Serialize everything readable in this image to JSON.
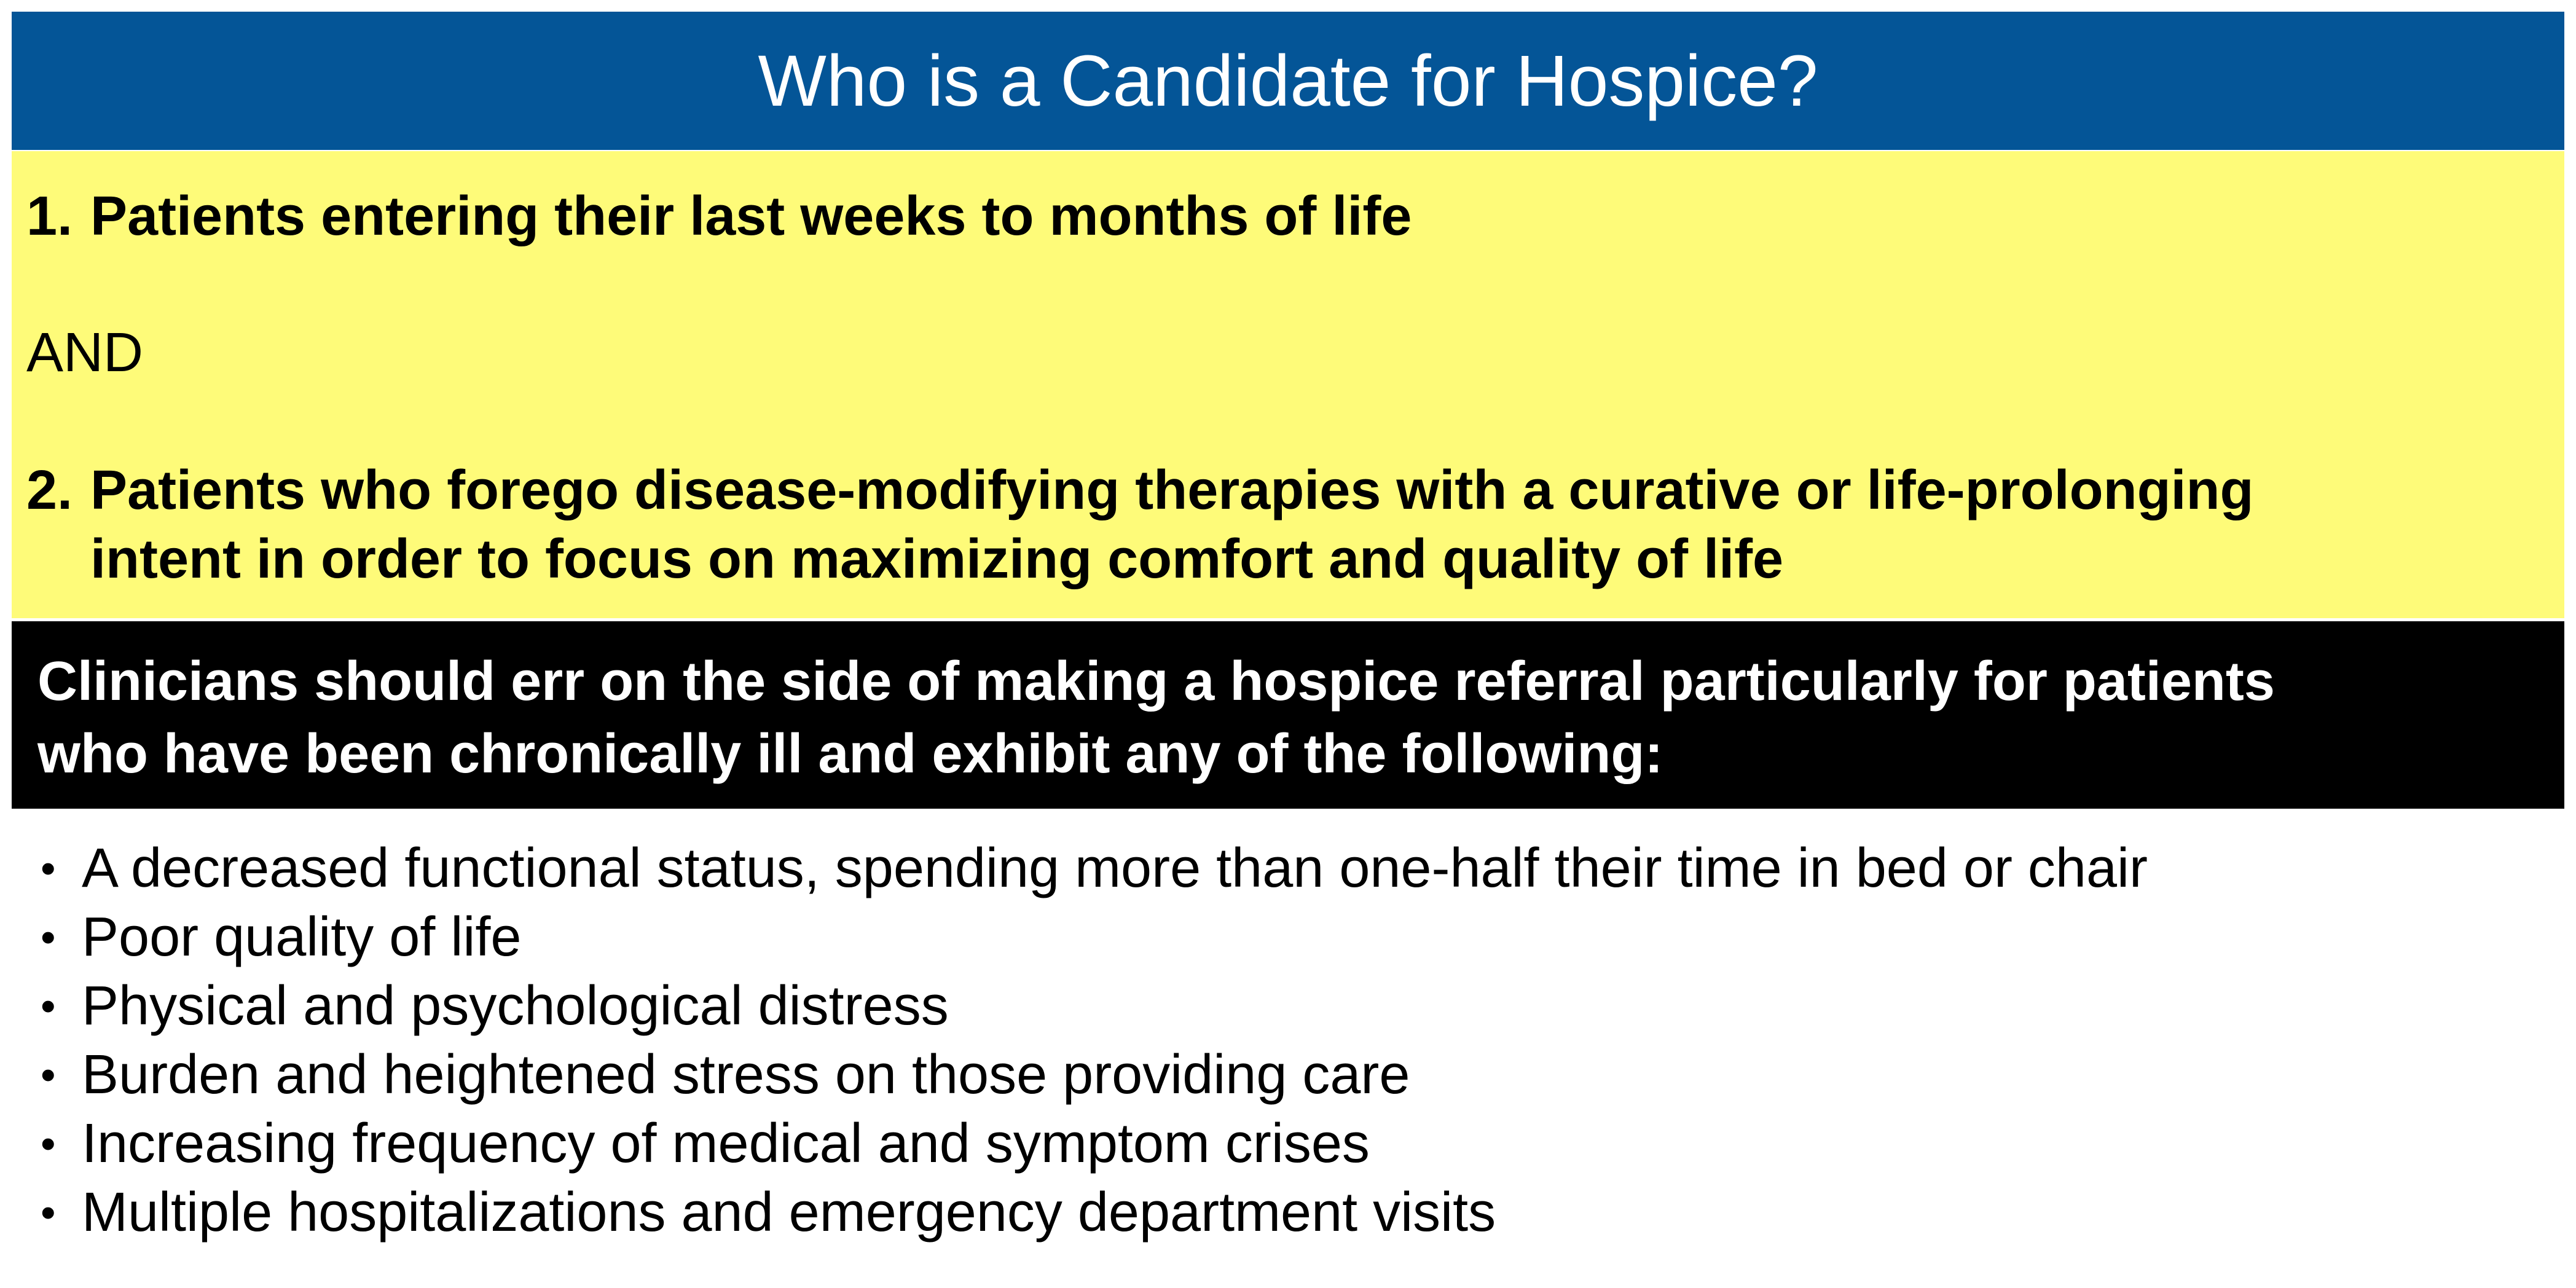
{
  "header": {
    "title": "Who is a Candidate for Hospice?"
  },
  "criteria": {
    "item1": {
      "number": "1.",
      "text": "Patients entering their last weeks to months of life"
    },
    "conjunction": "AND",
    "item2": {
      "number": "2.",
      "line1": "Patients who forego disease-modifying therapies with a curative or life-prolonging",
      "line2": "intent in order to focus on maximizing comfort and quality of life"
    }
  },
  "note": {
    "line1": "Clinicians should err on the side of making a hospice referral particularly for patients",
    "line2": "who have been chronically ill and exhibit any of the following:"
  },
  "bullets": {
    "marker": "•",
    "items": [
      "A decreased functional status, spending more than one-half their time in bed or chair",
      "Poor quality of life",
      "Physical and psychological distress",
      "Burden and heightened stress on those providing care",
      "Increasing frequency of medical and symptom crises",
      "Multiple hospitalizations and emergency department visits"
    ]
  },
  "colors": {
    "header_background": "#045597",
    "criteria_background": "#fefb79",
    "note_background": "#000000"
  }
}
